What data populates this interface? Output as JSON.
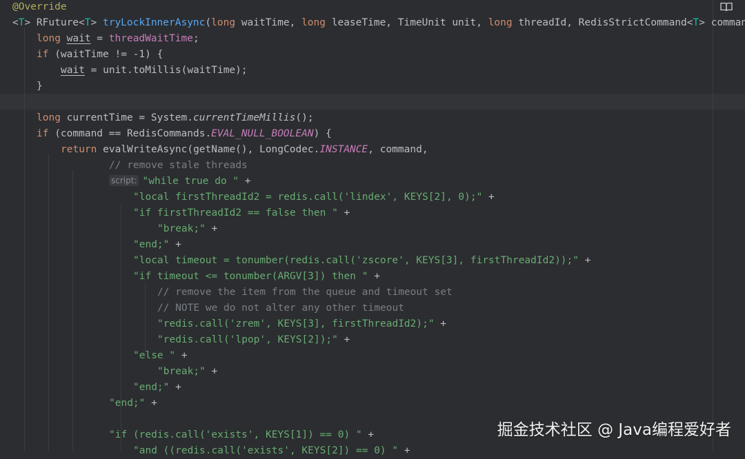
{
  "editor": {
    "lines": [
      {
        "indent": 0,
        "tokens": [
          {
            "t": "@Override",
            "c": "ann"
          }
        ]
      },
      {
        "indent": 0,
        "tokens": [
          {
            "t": "<",
            "c": ""
          },
          {
            "t": "T",
            "c": "tp"
          },
          {
            "t": "> RFuture<",
            "c": ""
          },
          {
            "t": "T",
            "c": "tp"
          },
          {
            "t": "> ",
            "c": ""
          },
          {
            "t": "tryLockInnerAsync",
            "c": "fn"
          },
          {
            "t": "(",
            "c": ""
          },
          {
            "t": "long",
            "c": "kw"
          },
          {
            "t": " waitTime, ",
            "c": ""
          },
          {
            "t": "long",
            "c": "kw"
          },
          {
            "t": " leaseTime, TimeUnit unit, ",
            "c": ""
          },
          {
            "t": "long",
            "c": "kw"
          },
          {
            "t": " threadId, RedisStrictCommand<",
            "c": ""
          },
          {
            "t": "T",
            "c": "tp"
          },
          {
            "t": "> command",
            "c": ""
          }
        ]
      },
      {
        "indent": 1,
        "tokens": [
          {
            "t": "long",
            "c": "kw"
          },
          {
            "t": " ",
            "c": ""
          },
          {
            "t": "wait",
            "c": "ul"
          },
          {
            "t": " = ",
            "c": ""
          },
          {
            "t": "threadWaitTime",
            "c": "fld"
          },
          {
            "t": ";",
            "c": ""
          }
        ]
      },
      {
        "indent": 1,
        "tokens": [
          {
            "t": "if",
            "c": "kw"
          },
          {
            "t": " (waitTime != -1) {",
            "c": ""
          }
        ]
      },
      {
        "indent": 2,
        "tokens": [
          {
            "t": "wait",
            "c": "ul"
          },
          {
            "t": " = unit.toMillis(waitTime);",
            "c": ""
          }
        ]
      },
      {
        "indent": 1,
        "tokens": [
          {
            "t": "}",
            "c": ""
          }
        ]
      },
      {
        "indent": 0,
        "tokens": []
      },
      {
        "indent": 1,
        "tokens": [
          {
            "t": "long",
            "c": "kw"
          },
          {
            "t": " currentTime = System.",
            "c": ""
          },
          {
            "t": "currentTimeMillis",
            "c": "it"
          },
          {
            "t": "();",
            "c": ""
          }
        ]
      },
      {
        "indent": 1,
        "tokens": [
          {
            "t": "if",
            "c": "kw"
          },
          {
            "t": " (command == RedisCommands.",
            "c": ""
          },
          {
            "t": "EVAL_NULL_BOOLEAN",
            "c": "st"
          },
          {
            "t": ") {",
            "c": ""
          }
        ]
      },
      {
        "indent": 2,
        "tokens": [
          {
            "t": "return",
            "c": "kw"
          },
          {
            "t": " evalWriteAsync(getName(), LongCodec.",
            "c": ""
          },
          {
            "t": "INSTANCE",
            "c": "st"
          },
          {
            "t": ", command,",
            "c": ""
          }
        ]
      },
      {
        "indent": 4,
        "tokens": [
          {
            "t": "// remove stale threads",
            "c": "cmt"
          }
        ]
      },
      {
        "indent": 4,
        "hint": "script:",
        "tokens": [
          {
            "t": "\"while true do \"",
            "c": "str"
          },
          {
            "t": " +",
            "c": ""
          }
        ]
      },
      {
        "indent": 5,
        "tokens": [
          {
            "t": "\"local firstThreadId2 = redis.call('lindex', KEYS[2], 0);\"",
            "c": "str"
          },
          {
            "t": " +",
            "c": ""
          }
        ]
      },
      {
        "indent": 5,
        "tokens": [
          {
            "t": "\"if firstThreadId2 == false then \"",
            "c": "str"
          },
          {
            "t": " +",
            "c": ""
          }
        ]
      },
      {
        "indent": 6,
        "tokens": [
          {
            "t": "\"break;\"",
            "c": "str"
          },
          {
            "t": " +",
            "c": ""
          }
        ]
      },
      {
        "indent": 5,
        "tokens": [
          {
            "t": "\"end;\"",
            "c": "str"
          },
          {
            "t": " +",
            "c": ""
          }
        ]
      },
      {
        "indent": 5,
        "tokens": [
          {
            "t": "\"local timeout = tonumber(redis.call('zscore', KEYS[3], firstThreadId2));\"",
            "c": "str"
          },
          {
            "t": " +",
            "c": ""
          }
        ]
      },
      {
        "indent": 5,
        "tokens": [
          {
            "t": "\"if timeout <= tonumber(ARGV[3]) then \"",
            "c": "str"
          },
          {
            "t": " +",
            "c": ""
          }
        ]
      },
      {
        "indent": 6,
        "tokens": [
          {
            "t": "// remove the item from the queue and timeout set",
            "c": "cmt"
          }
        ]
      },
      {
        "indent": 6,
        "tokens": [
          {
            "t": "// NOTE we do not alter any other timeout",
            "c": "cmt"
          }
        ]
      },
      {
        "indent": 6,
        "tokens": [
          {
            "t": "\"redis.call('zrem', KEYS[3], firstThreadId2);\"",
            "c": "str"
          },
          {
            "t": " +",
            "c": ""
          }
        ]
      },
      {
        "indent": 6,
        "tokens": [
          {
            "t": "\"redis.call('lpop', KEYS[2]);\"",
            "c": "str"
          },
          {
            "t": " +",
            "c": ""
          }
        ]
      },
      {
        "indent": 5,
        "tokens": [
          {
            "t": "\"else \"",
            "c": "str"
          },
          {
            "t": " +",
            "c": ""
          }
        ]
      },
      {
        "indent": 6,
        "tokens": [
          {
            "t": "\"break;\"",
            "c": "str"
          },
          {
            "t": " +",
            "c": ""
          }
        ]
      },
      {
        "indent": 5,
        "tokens": [
          {
            "t": "\"end;\"",
            "c": "str"
          },
          {
            "t": " +",
            "c": ""
          }
        ]
      },
      {
        "indent": 4,
        "tokens": [
          {
            "t": "\"end;\"",
            "c": "str"
          },
          {
            "t": " +",
            "c": ""
          }
        ]
      },
      {
        "indent": 0,
        "tokens": []
      },
      {
        "indent": 4,
        "tokens": [
          {
            "t": "\"if (redis.call('exists', KEYS[1]) == 0) \"",
            "c": "str"
          },
          {
            "t": " +",
            "c": ""
          }
        ]
      },
      {
        "indent": 5,
        "tokens": [
          {
            "t": "\"and ((redis.call('exists', KEYS[2]) == 0) \"",
            "c": "str"
          },
          {
            "t": " +",
            "c": ""
          }
        ]
      }
    ]
  },
  "toolbar": {
    "reader_mode_icon": "book-icon"
  },
  "watermark": {
    "text": "掘金技术社区 @ Java编程爱好者"
  },
  "colors": {
    "background": "#2b2d30",
    "keyword": "#cf8e6d",
    "annotation": "#b3ae60",
    "method": "#56a8f5",
    "field": "#c77dbb",
    "string": "#6aab73",
    "comment": "#7a7e85",
    "type_param": "#16baac"
  }
}
